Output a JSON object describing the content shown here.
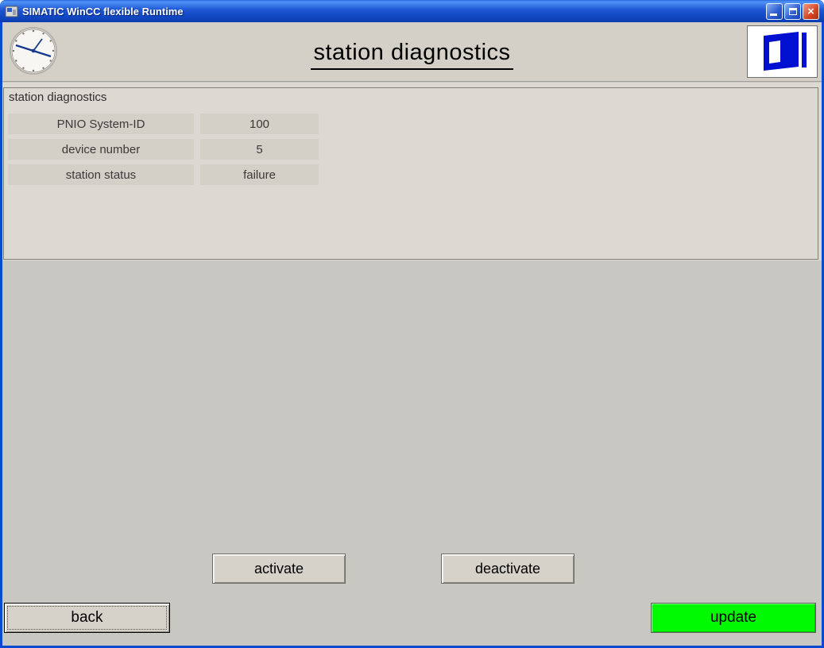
{
  "window": {
    "title": "SIMATIC WinCC flexible Runtime"
  },
  "header": {
    "title": "station diagnostics"
  },
  "diagnostics": {
    "group_label": "station diagnostics",
    "rows": [
      {
        "label": "PNIO System-ID",
        "value": "100"
      },
      {
        "label": "device number",
        "value": "5"
      },
      {
        "label": "station status",
        "value": "failure"
      }
    ]
  },
  "actions": {
    "activate": "activate",
    "deactivate": "deactivate",
    "back": "back",
    "update": "update"
  },
  "icons": {
    "close_glyph": "×"
  },
  "colors": {
    "titlebar_blue": "#0a49d0",
    "update_button_bg": "#00fb00",
    "door_icon_blue": "#000fd0",
    "button_face": "#d6d2ca"
  }
}
